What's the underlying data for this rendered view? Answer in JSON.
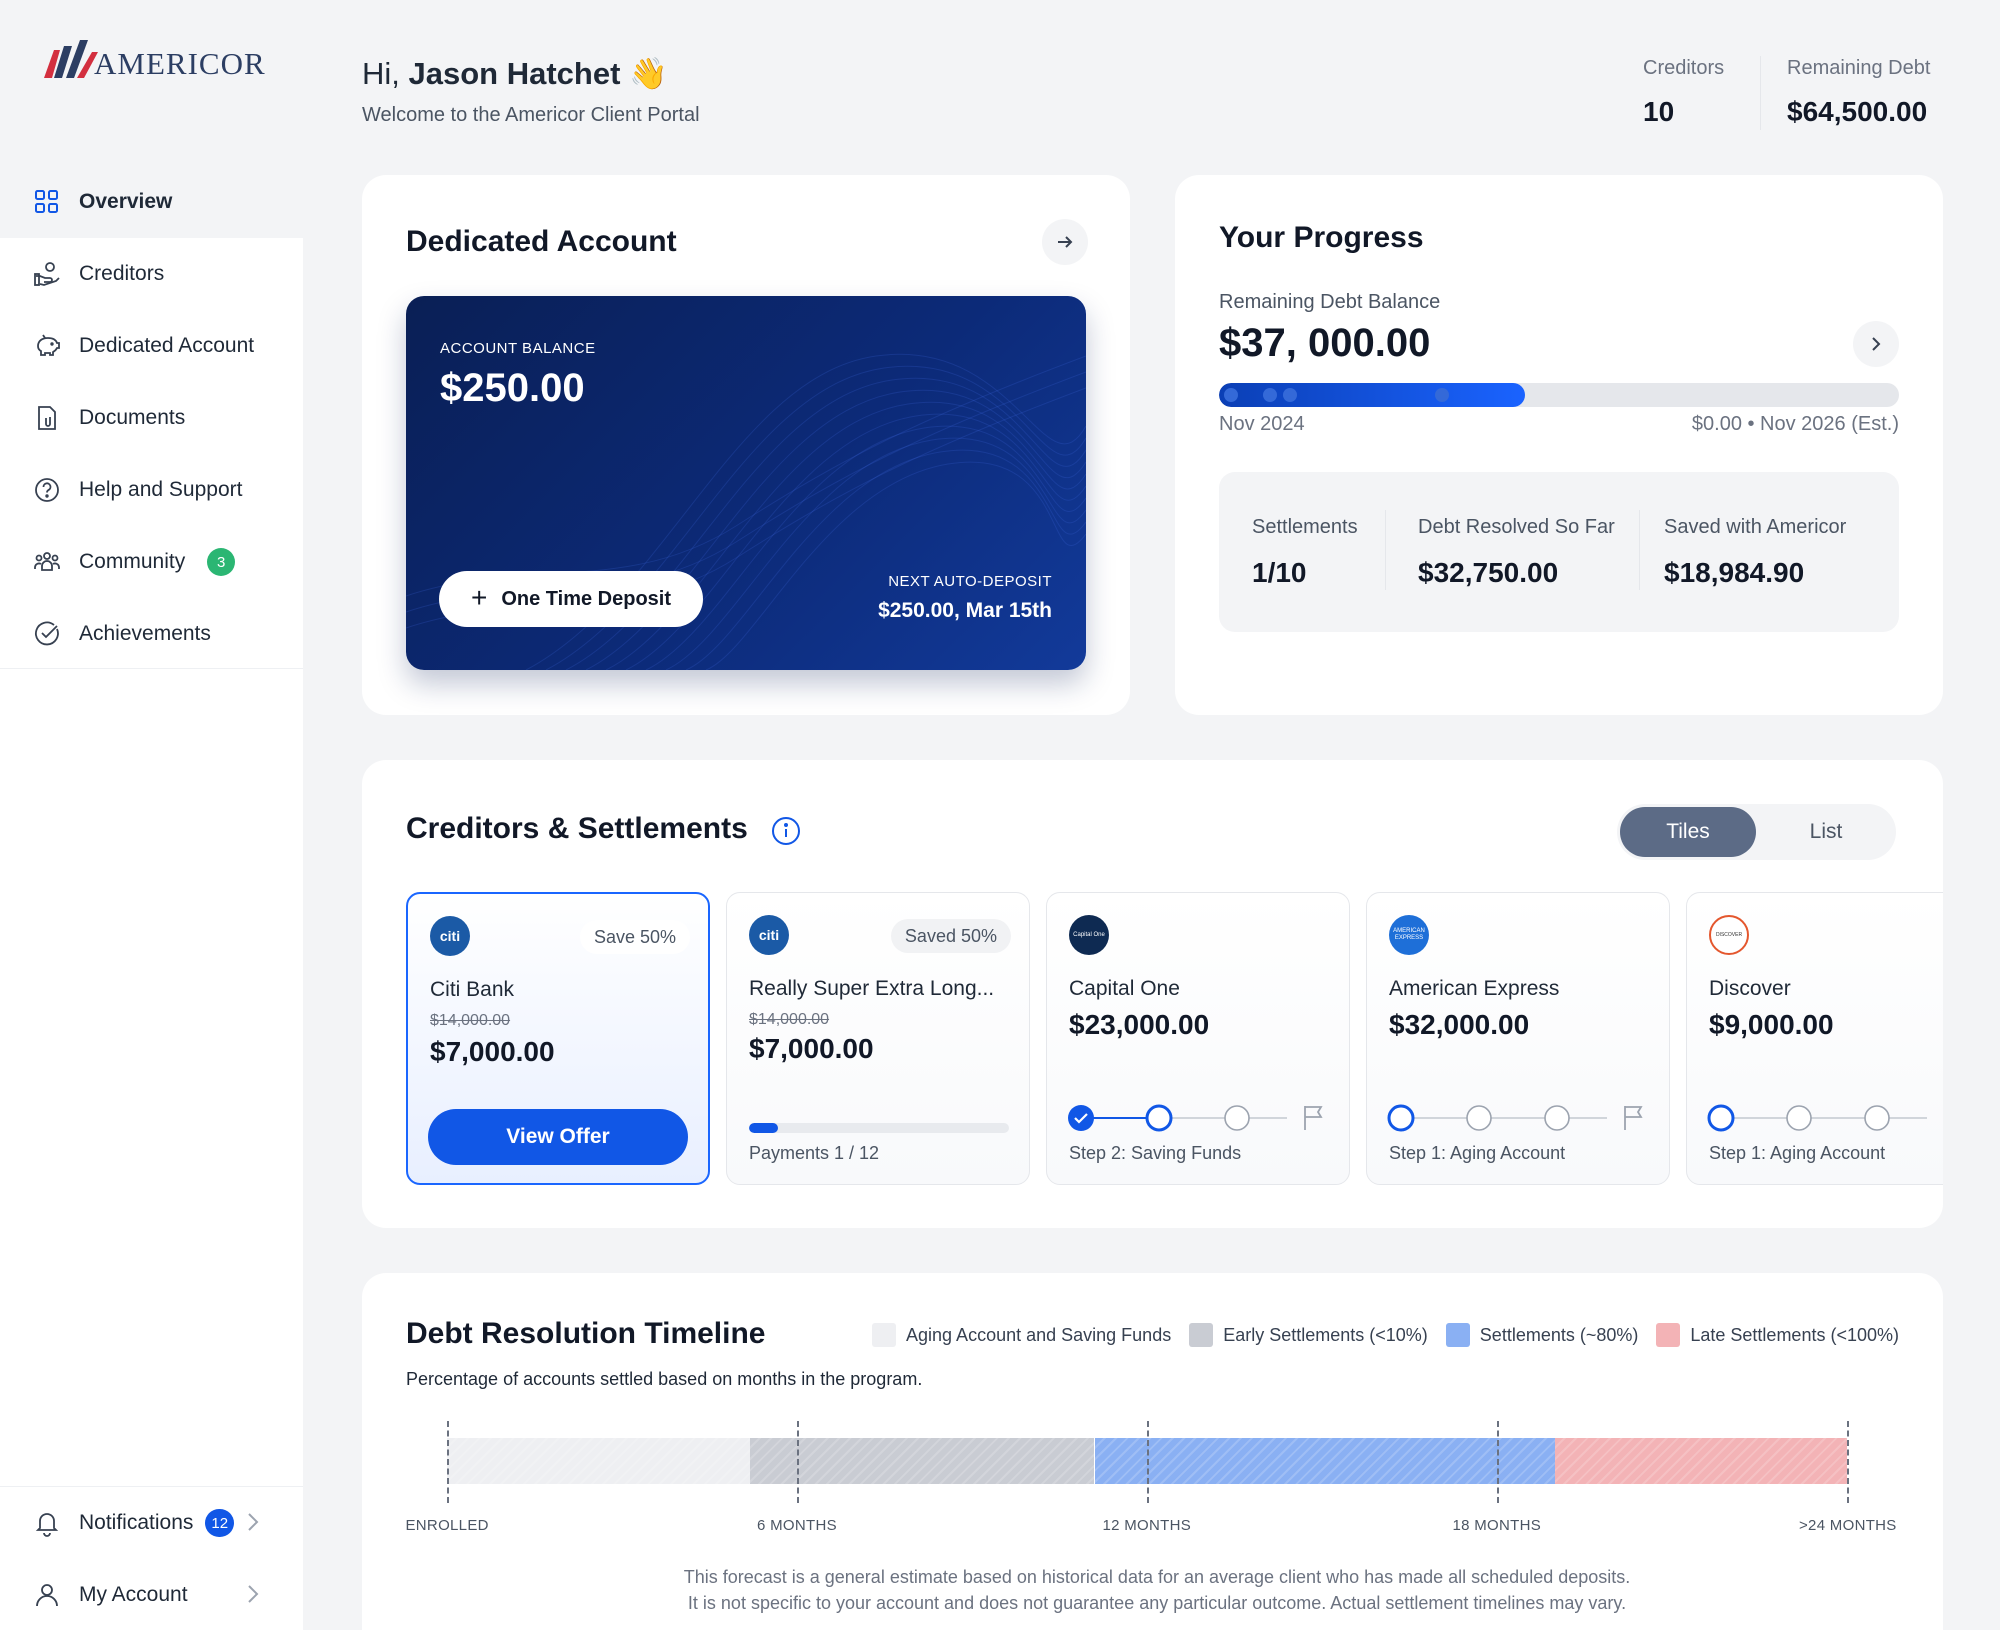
{
  "brand": {
    "name": "AMERICOR",
    "accent": "#1157e6",
    "logo_red": "#d32f3f",
    "logo_navy": "#2c3e63"
  },
  "sidebar": {
    "items": [
      {
        "id": "overview",
        "label": "Overview",
        "icon": "grid-icon",
        "active": true
      },
      {
        "id": "creditors",
        "label": "Creditors",
        "icon": "hand-coins-icon"
      },
      {
        "id": "dedicated-account",
        "label": "Dedicated Account",
        "icon": "piggy-bank-icon"
      },
      {
        "id": "documents",
        "label": "Documents",
        "icon": "document-icon"
      },
      {
        "id": "help",
        "label": "Help and Support",
        "icon": "question-circle-icon"
      },
      {
        "id": "community",
        "label": "Community",
        "icon": "people-icon",
        "badge": "3"
      },
      {
        "id": "achievements",
        "label": "Achievements",
        "icon": "check-circle-icon"
      }
    ],
    "bottom": [
      {
        "id": "notifications",
        "label": "Notifications",
        "icon": "bell-icon",
        "badge": "12"
      },
      {
        "id": "my-account",
        "label": "My Account",
        "icon": "user-icon"
      }
    ]
  },
  "header": {
    "greeting_prefix": "Hi,",
    "user_name": "Jason Hatchet",
    "wave": "👋",
    "welcome": "Welcome to the Americor Client Portal",
    "creditors_label": "Creditors",
    "creditors_value": "10",
    "remaining_label": "Remaining Debt",
    "remaining_value": "$64,500.00"
  },
  "dedicated_account": {
    "title": "Dedicated Account",
    "balance_label": "ACCOUNT BALANCE",
    "balance_value": "$250.00",
    "deposit_button": "One Time Deposit",
    "next_label": "NEXT AUTO-DEPOSIT",
    "next_value": "$250.00, Mar 15th"
  },
  "progress": {
    "title": "Your Progress",
    "remaining_label": "Remaining Debt Balance",
    "remaining_value": "$37, 000.00",
    "fraction": 0.45,
    "dots": [
      0.017,
      0.075,
      0.105,
      0.328
    ],
    "start_label": "Nov 2024",
    "end_label": "$0.00 • Nov 2026 (Est.)",
    "stats": [
      {
        "label": "Settlements",
        "value": "1/10"
      },
      {
        "label": "Debt Resolved So Far",
        "value": "$32,750.00"
      },
      {
        "label": "Saved with Americor",
        "value": "$18,984.90"
      }
    ]
  },
  "creditors": {
    "title": "Creditors & Settlements",
    "view_tiles": "Tiles",
    "view_list": "List",
    "tiles": [
      {
        "name": "Citi Bank",
        "logo": "citi",
        "logo_color": "#1b5aa6",
        "pill": "Save 50%",
        "original": "$14,000.00",
        "amount": "$7,000.00",
        "button": "View Offer",
        "selected": true
      },
      {
        "name": "Really Super Extra Long...",
        "logo": "citi",
        "logo_color": "#1b5aa6",
        "pill": "Saved 50%",
        "original": "$14,000.00",
        "amount": "$7,000.00",
        "payments_label": "Payments 1 / 12",
        "payments_fraction": 0.0833
      },
      {
        "name": "Capital One",
        "logo": "Capital One",
        "logo_color": "#0e2a52",
        "amount": "$23,000.00",
        "step_label": "Step 2: Saving Funds",
        "step": 2
      },
      {
        "name": "American Express",
        "logo": "AMERICAN EXPRESS",
        "logo_color": "#1e6fd8",
        "amount": "$32,000.00",
        "step_label": "Step 1: Aging Account",
        "step": 1
      },
      {
        "name": "Discover",
        "logo": "DISCOVER",
        "logo_color": "#e4572e",
        "amount": "$9,000.00",
        "step_label": "Step 1: Aging Account",
        "step": 1
      }
    ]
  },
  "timeline": {
    "title": "Debt Resolution Timeline",
    "subtitle": "Percentage of accounts settled based on months in the program.",
    "legend": [
      {
        "label": "Aging Account and Saving Funds",
        "color": "#eeeff2"
      },
      {
        "label": "Early Settlements (<10%)",
        "color": "#c9ccd3"
      },
      {
        "label": "Settlements (~80%)",
        "color": "#8ab0f3"
      },
      {
        "label": "Late Settlements (<100%)",
        "color": "#f3b3b6"
      }
    ],
    "segments": [
      {
        "months_from": 0,
        "months_to": 5.2,
        "color": "#eeeff2"
      },
      {
        "months_from": 5.2,
        "months_to": 11.1,
        "color": "#c9ccd3"
      },
      {
        "months_from": 11.1,
        "months_to": 19.0,
        "color": "#8ab0f3"
      },
      {
        "months_from": 19.0,
        "months_to": 24.0,
        "color": "#f3b3b6"
      }
    ],
    "ticks": [
      {
        "months": 0,
        "label": "ENROLLED"
      },
      {
        "months": 6,
        "label": "6 MONTHS"
      },
      {
        "months": 12,
        "label": "12 MONTHS"
      },
      {
        "months": 18,
        "label": "18 MONTHS"
      },
      {
        "months": 24,
        "label": ">24 MONTHS"
      }
    ],
    "disclaimer_1": "This forecast is a general estimate based on historical data for an average client who has made all scheduled deposits.",
    "disclaimer_2": "It is not specific to your account and does not guarantee any particular outcome. Actual settlement timelines may vary."
  }
}
